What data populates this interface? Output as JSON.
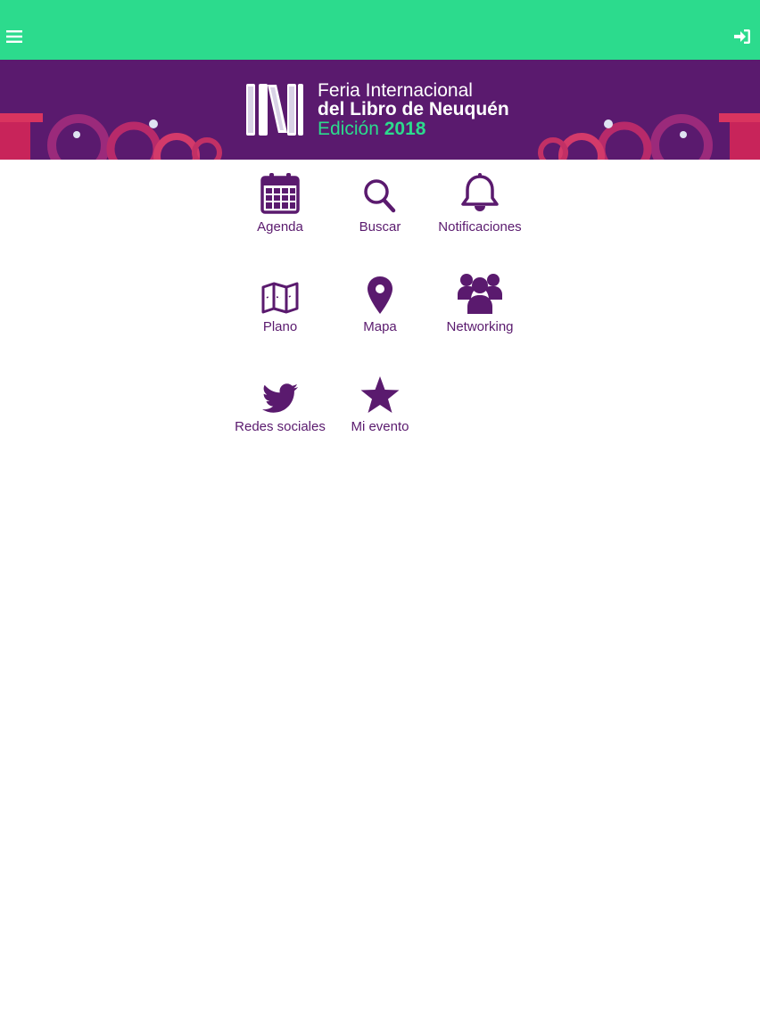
{
  "colors": {
    "topbar": "#2cdb8d",
    "brand_purple": "#5a1a6e",
    "accent_green": "#2cdb8d"
  },
  "header": {
    "menu_icon": "hamburger-menu-icon",
    "login_icon": "sign-in-icon"
  },
  "banner": {
    "line1": "Feria Internacional",
    "line2": "del Libro de Neuquén",
    "line3_prefix": "Edición ",
    "line3_year": "2018"
  },
  "tiles": [
    {
      "label": "Agenda",
      "icon": "calendar-icon"
    },
    {
      "label": "Buscar",
      "icon": "search-icon"
    },
    {
      "label": "Notificaciones",
      "icon": "bell-icon"
    },
    {
      "label": "Plano",
      "icon": "map-icon"
    },
    {
      "label": "Mapa",
      "icon": "map-marker-icon"
    },
    {
      "label": "Networking",
      "icon": "users-icon"
    },
    {
      "label": "Redes sociales",
      "icon": "twitter-icon"
    },
    {
      "label": "Mi evento",
      "icon": "star-icon"
    }
  ]
}
